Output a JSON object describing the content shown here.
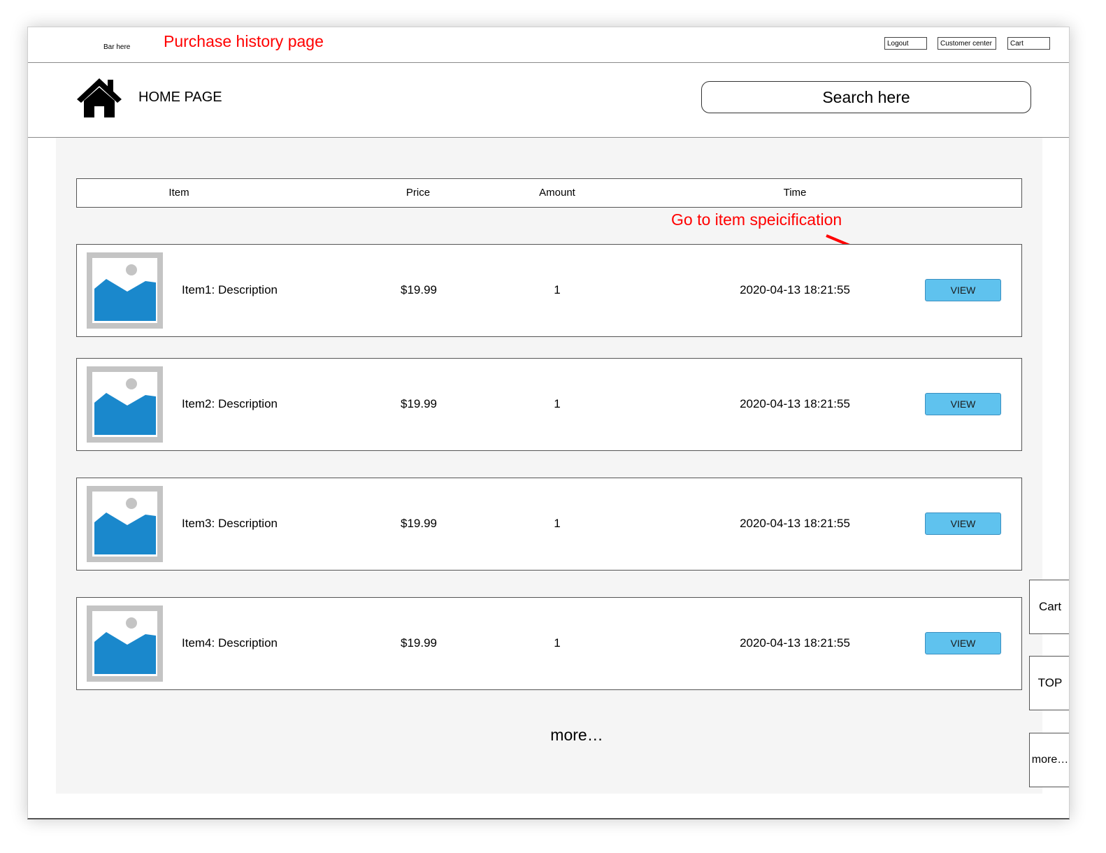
{
  "topbar": {
    "bar_label": "Bar here",
    "page_note": "Purchase history page",
    "logout_label": "Logout",
    "customer_center_label": "Customer center",
    "cart_label": "Cart"
  },
  "header": {
    "home_icon": "home-icon",
    "home_label": "HOME PAGE",
    "search_placeholder": "Search here"
  },
  "table": {
    "columns": [
      "Item",
      "Price",
      "Amount",
      "Time"
    ],
    "annotation": "Go to item speicification",
    "rows": [
      {
        "name": "Item1: Description",
        "price": "$19.99",
        "amount": "1",
        "time": "2020-04-13 18:21:55",
        "action": "VIEW"
      },
      {
        "name": "Item2: Description",
        "price": "$19.99",
        "amount": "1",
        "time": "2020-04-13 18:21:55",
        "action": "VIEW"
      },
      {
        "name": "Item3: Description",
        "price": "$19.99",
        "amount": "1",
        "time": "2020-04-13 18:21:55",
        "action": "VIEW"
      },
      {
        "name": "Item4: Description",
        "price": "$19.99",
        "amount": "1",
        "time": "2020-04-13 18:21:55",
        "action": "VIEW"
      }
    ],
    "more_label": "more…"
  },
  "side_buttons": {
    "cart": "Cart",
    "top": "TOP",
    "more": "more…"
  },
  "colors": {
    "annotation": "#ff0000",
    "view_button": "#5fc2ee",
    "image_placeholder": "#1a88cc"
  }
}
